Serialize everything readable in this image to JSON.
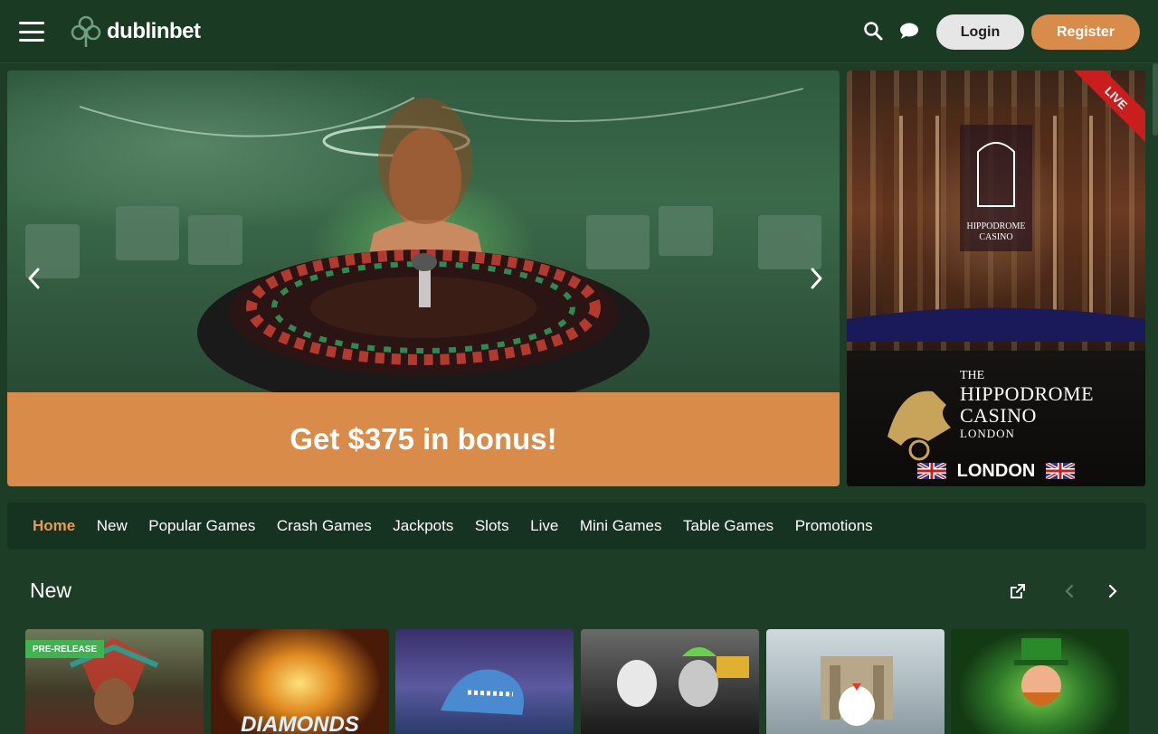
{
  "header": {
    "logo_text": "dublinbet",
    "login_label": "Login",
    "register_label": "Register"
  },
  "hero": {
    "bonus_text": "Get $375 in bonus!"
  },
  "side_card": {
    "live_label": "LIVE",
    "title_the": "THE",
    "title_line1": "HIPPODROME",
    "title_line2": "CASINO",
    "title_line3": "LONDON",
    "city_label": "LONDON"
  },
  "categories": [
    {
      "label": "Home",
      "active": true
    },
    {
      "label": "New"
    },
    {
      "label": "Popular Games"
    },
    {
      "label": "Crash Games"
    },
    {
      "label": "Jackpots"
    },
    {
      "label": "Slots"
    },
    {
      "label": "Live"
    },
    {
      "label": "Mini Games"
    },
    {
      "label": "Table Games"
    },
    {
      "label": "Promotions"
    }
  ],
  "section": {
    "title": "New"
  },
  "tiles": [
    {
      "badge": "PRE-RELEASE",
      "word": ""
    },
    {
      "badge": "",
      "word": "DIAMONDS"
    },
    {
      "badge": "",
      "word": ""
    },
    {
      "badge": "",
      "word": ""
    },
    {
      "badge": "",
      "word": ""
    },
    {
      "badge": "",
      "word": ""
    }
  ],
  "colors": {
    "accent": "#d98c4a",
    "background": "#1d3d27",
    "nav_bg": "#163322",
    "badge": "#3fb34f",
    "live": "#c81e1e"
  },
  "icons": [
    "hamburger-icon",
    "clover-logo-icon",
    "search-icon",
    "chat-icon",
    "chevron-left-icon",
    "chevron-right-icon",
    "external-link-icon",
    "uk-flag-icon"
  ]
}
